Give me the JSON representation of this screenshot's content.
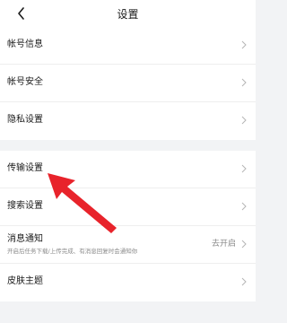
{
  "header": {
    "back_icon": "back-arrow-icon",
    "title": "设置"
  },
  "settings": {
    "group1": [
      {
        "label": "帐号信息"
      },
      {
        "label": "帐号安全"
      },
      {
        "label": "隐私设置"
      }
    ],
    "group2": [
      {
        "label": "传输设置"
      },
      {
        "label": "搜索设置"
      },
      {
        "label": "消息通知",
        "sublabel": "开启后任务下载/上传完成、有消息回复时会通知你",
        "value": "去开启"
      },
      {
        "label": "皮肤主题"
      }
    ]
  },
  "annotation": {
    "type": "red-arrow",
    "target": "传输设置",
    "color": "#e8232b"
  }
}
